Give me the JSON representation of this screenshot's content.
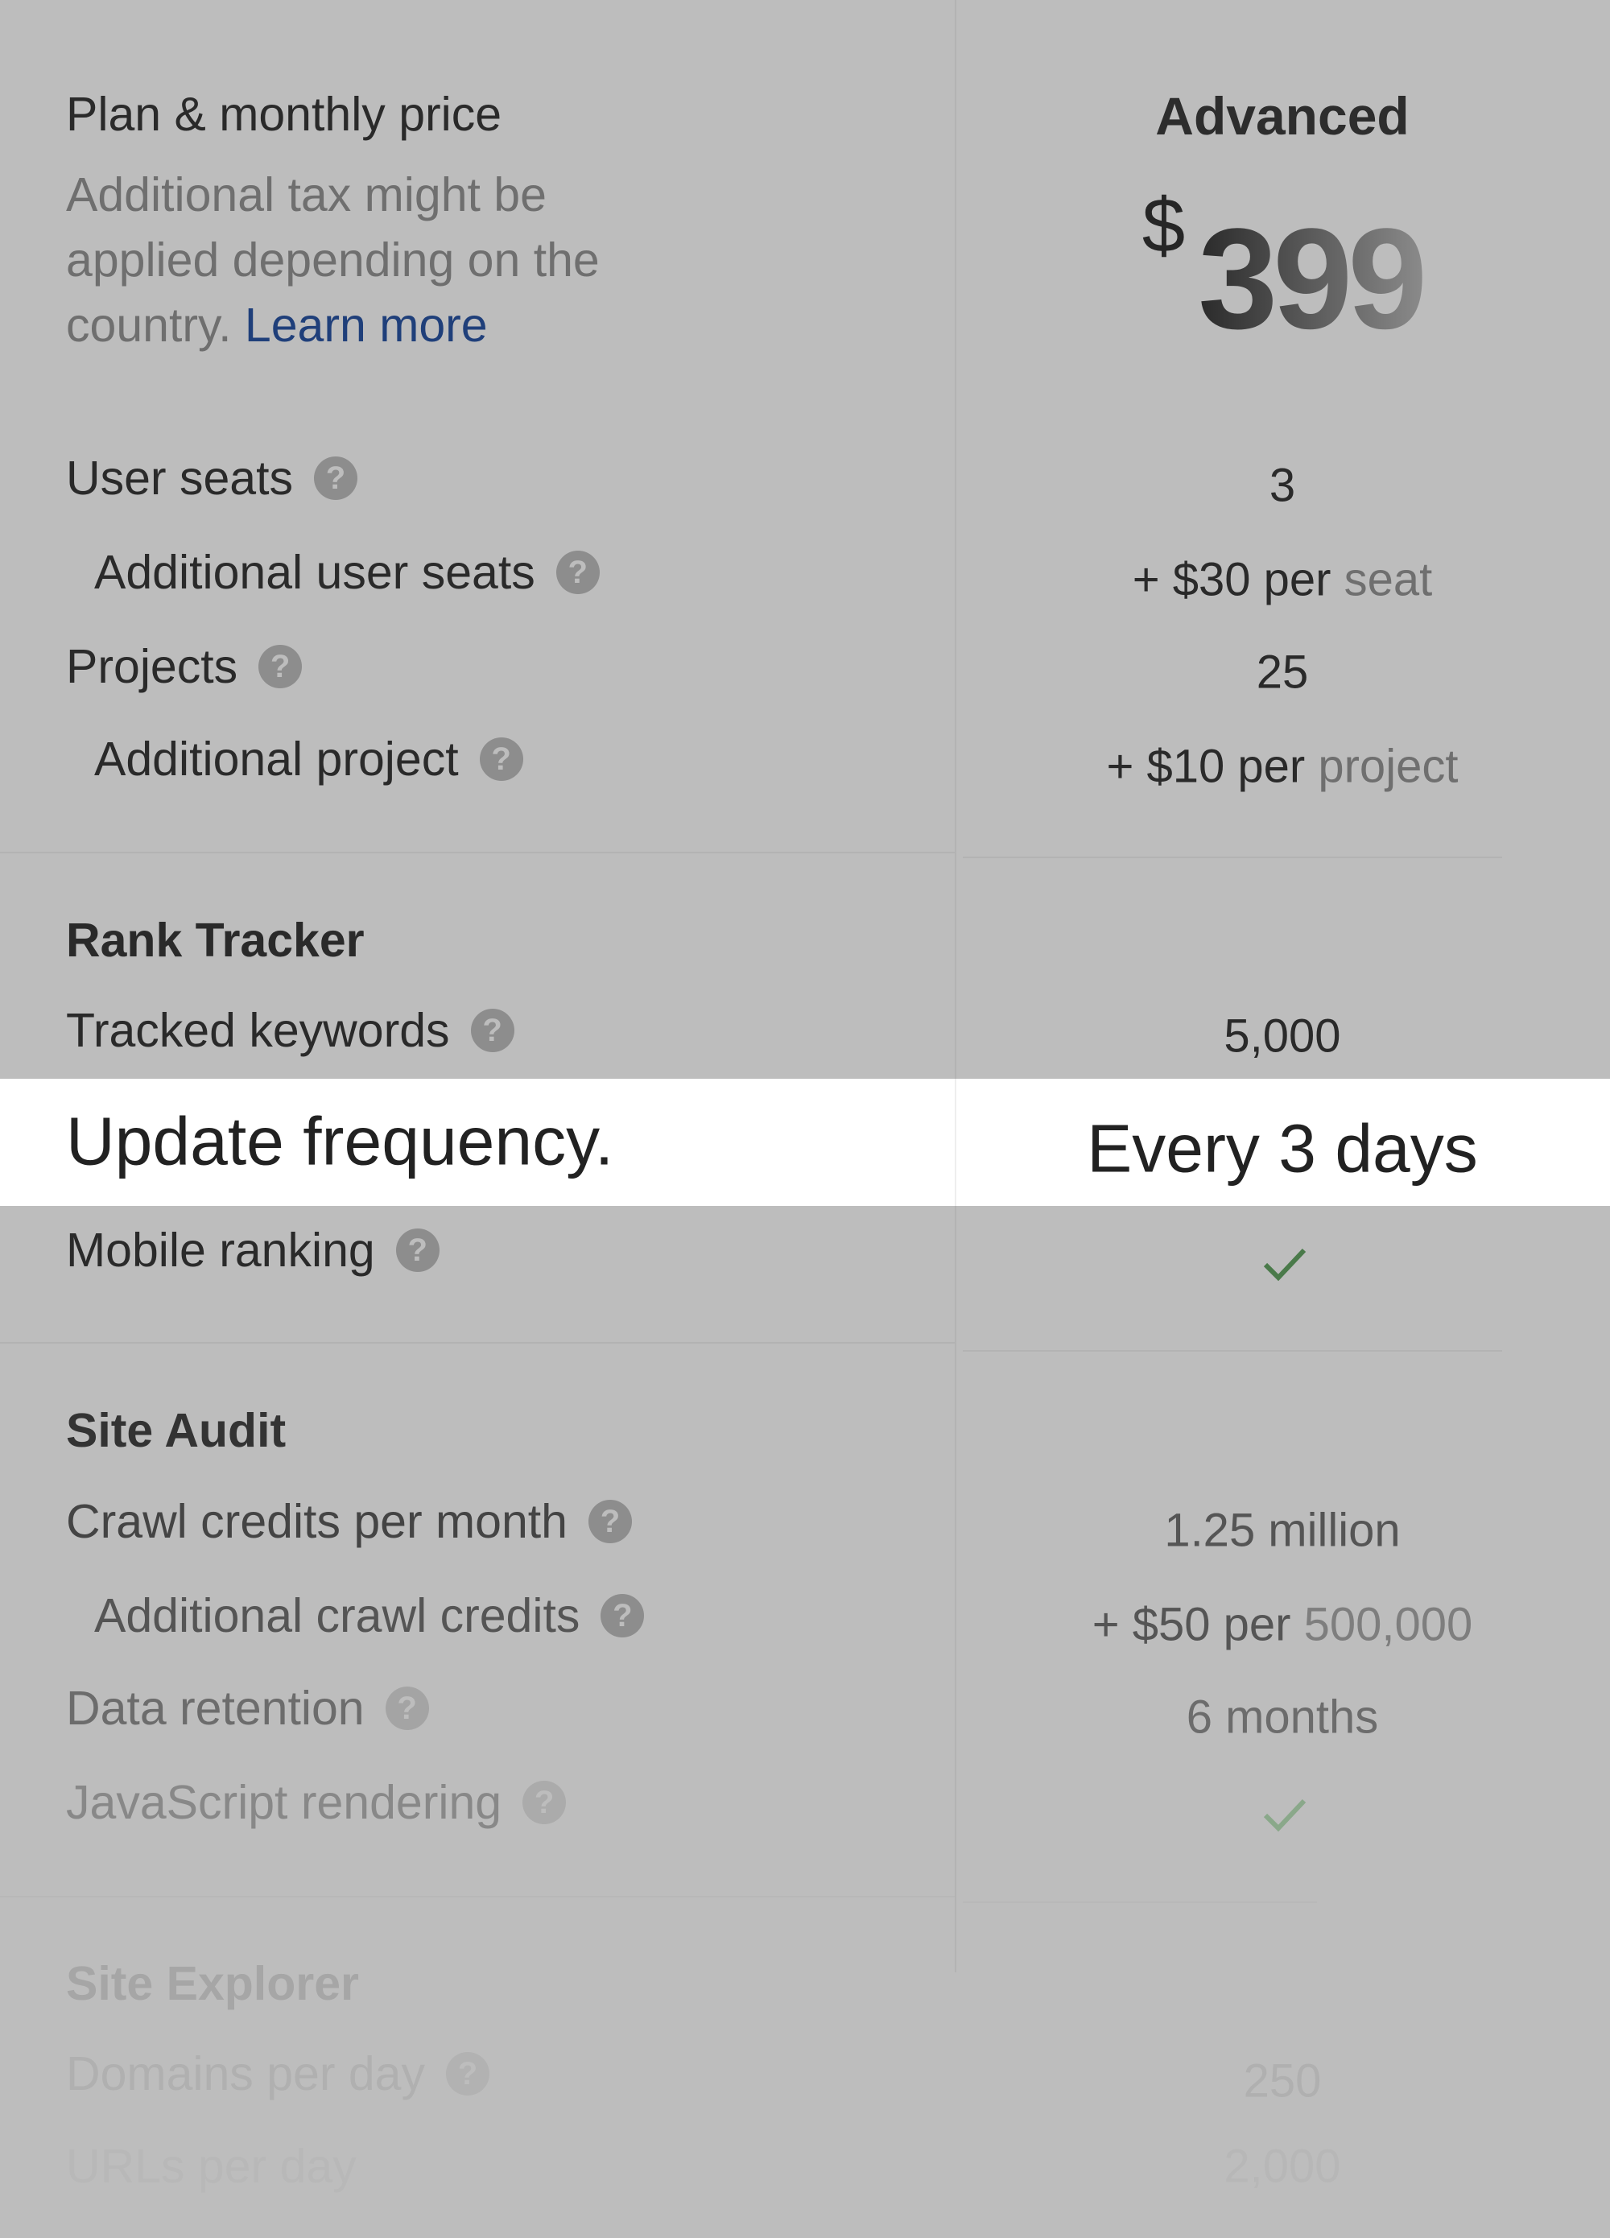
{
  "plan": {
    "title": "Plan & monthly price",
    "note": "Additional tax might be",
    "note2": "applied depending on the",
    "note3": "country.",
    "learn_more": "Learn more",
    "name": "Advanced",
    "currency": "$",
    "price": "399"
  },
  "limits": [
    {
      "label": "User seats",
      "value": "3"
    },
    {
      "label": "Additional user seats",
      "value_strong": "+ $30 per",
      "value_muted": "seat"
    },
    {
      "label": "Projects",
      "value": "25"
    },
    {
      "label": "Additional project",
      "value_strong": "+ $10 per",
      "value_muted": "project"
    }
  ],
  "rank_tracker": {
    "title": "Rank Tracker",
    "tracked_keywords": "Tracked keywords",
    "tracked_keywords_value": "5,000",
    "update_frequency": "Update frequency.",
    "update_frequency_value": "Every 3 days",
    "mobile_ranking": "Mobile ranking",
    "mobile_ranking_included": true
  },
  "site_audit": {
    "title": "Site Audit",
    "crawl_credits": "Crawl credits per month",
    "crawl_credits_value": "1.25 million",
    "additional_crawl": "Additional crawl credits",
    "additional_crawl_strong": "+ $50 per",
    "additional_crawl_muted": "500,000",
    "data_retention": "Data retention",
    "data_retention_value": "6 months",
    "js_rendering": "JavaScript rendering",
    "js_rendering_included": true
  },
  "site_explorer": {
    "title": "Site Explorer",
    "domains": "Domains per day",
    "domains_value": "250",
    "urls": "URLs per day",
    "urls_value": "2,000"
  },
  "colors": {
    "background": "#bdbdbd",
    "highlight": "#ffffff",
    "link": "#1f3f7a",
    "check": "#4a7a4a"
  }
}
